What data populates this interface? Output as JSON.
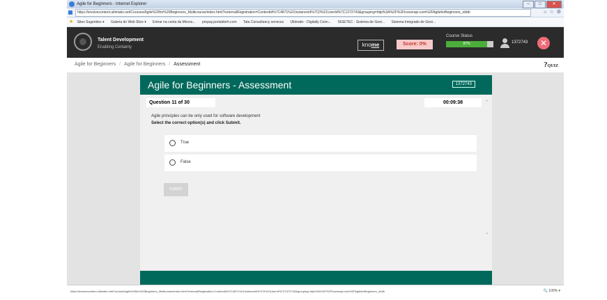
{
  "window": {
    "title": "Agile for Beginners - Internet Explorer",
    "url": "https://ievolvecontent.ultimatix.net/Courses/Agile%20for%20Beginners_Multicourse/index.html?externalRegistration=ContentId%7C4871%21InstanceId%7C0%21UserId%7C1372743&grouping=http%3A%2F%2Ftcsnerapi.com%2FAgileforBeginners_obttb",
    "favorites": [
      "Sites Sugeridos ▾",
      "Galeria do Web Slice ▾",
      "Entrar na conta da Micros...",
      "propay.portaldorh.com",
      "Tata Consultancy services",
      "Ultimatix - Digitally Conn...",
      "SIGETEC - Sistema de Gest...",
      "Sistema Integrado de Gest..."
    ],
    "status_url": "https://ievolvecontent.ultimatix.net/Courses/Agile%20for%20Beginners_Multicourse/index.html?externalRegistration=ContentId%7C4871%21InstanceId%7C0%21UserId%7C1372743&grouping=http%3A%2F%2Ftcsnerapi.com%2FAgileforBeginners_obttb",
    "zoom": "100%"
  },
  "header": {
    "brand": "Talent Development",
    "tagline": "Enabling Certainty",
    "knome_prefix": "kno",
    "knome_suffix": "me",
    "score": "Score: 0%",
    "course_status_label": "Course Status",
    "course_progress": "87%",
    "course_progress_value": 87,
    "user_id": "1372743"
  },
  "breadcrumb": {
    "items": [
      "Agile for Beginners",
      "Agile for Beginners",
      "Assessment"
    ],
    "quiz_label": "QUIZ"
  },
  "assessment": {
    "title": "Agile for Beginners - Assessment",
    "user_badge": "1372743",
    "question_counter": "Question 11 of 30",
    "timer": "00:09:38",
    "question": "Agile principles can be only used for software development",
    "instruction": "Select the correct option(s) and click Submit.",
    "options": [
      "True",
      "False"
    ],
    "submit_label": "SUBMIT"
  },
  "colors": {
    "header_bg": "#2b2b2b",
    "accent_teal": "#00695c",
    "score_text": "#c0392b",
    "progress_green": "#4cae3a",
    "close_pink": "#f06b78"
  }
}
